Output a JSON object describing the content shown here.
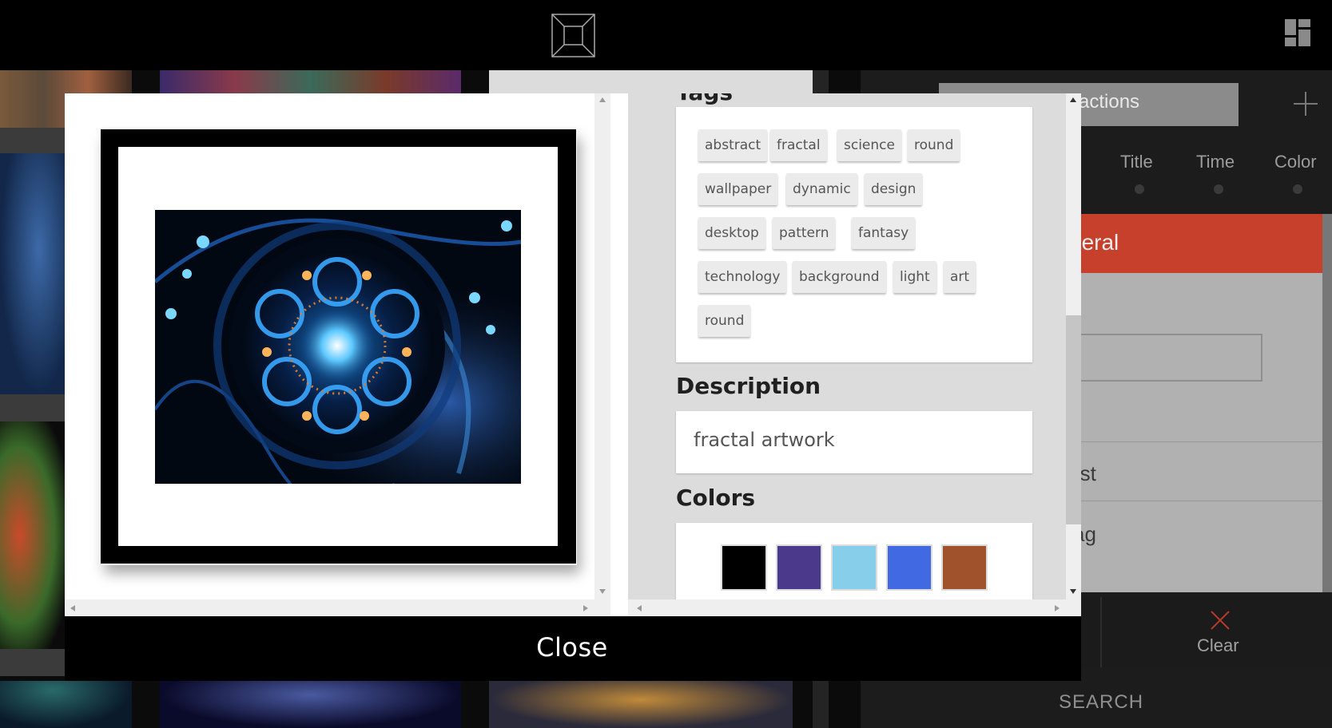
{
  "header": {
    "logo_icon": "square-frame-logo-icon",
    "layout_icon": "grid-layout-icon"
  },
  "background": {
    "collection_select": "actions",
    "sort_options": [
      "Title",
      "Time",
      "Color"
    ],
    "filter_section": "neral",
    "filter_rows": [
      "rtist",
      "Tag"
    ],
    "clear_label": "Clear",
    "search_label": "SEARCH"
  },
  "dialog": {
    "tags": [
      "abstract",
      "fractal",
      "science",
      "round",
      "wallpaper",
      "dynamic",
      "design",
      "desktop",
      "pattern",
      "fantasy",
      "technology",
      "background",
      "light",
      "art",
      "round"
    ],
    "description_title": "Description",
    "description": "fractal artwork",
    "colors_title": "Colors",
    "colors": [
      "#000000",
      "#4b3a8c",
      "#87ceeb",
      "#4169e1",
      "#a0522d"
    ],
    "close_label": "Close"
  }
}
